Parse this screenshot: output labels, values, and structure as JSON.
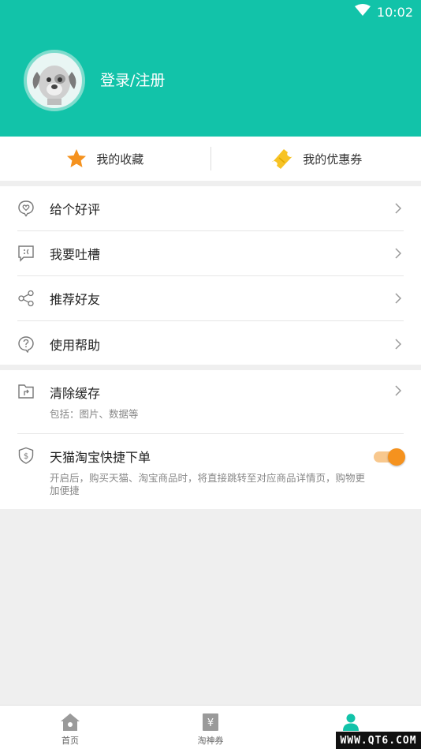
{
  "status": {
    "time": "10:02"
  },
  "profile": {
    "login_text": "登录/注册"
  },
  "quick": {
    "favorites_label": "我的收藏",
    "coupons_label": "我的优惠券"
  },
  "menu": {
    "rate_label": "给个好评",
    "feedback_label": "我要吐槽",
    "recommend_label": "推荐好友",
    "help_label": "使用帮助"
  },
  "settings": {
    "clear_cache_label": "清除缓存",
    "clear_cache_sub": "包括：图片、数据等",
    "quick_order_label": "天猫淘宝快捷下单",
    "quick_order_sub": "开启后，购买天猫、淘宝商品时，将直接跳转至对应商品详情页，购物更加便捷",
    "quick_order_enabled": true
  },
  "tabbar": {
    "home_label": "首页",
    "coupon_label": "淘神券",
    "mine_label": ""
  },
  "watermark": "WWW.QT6.COM",
  "colors": {
    "brand": "#12c3a9",
    "accent": "#f5921e"
  }
}
